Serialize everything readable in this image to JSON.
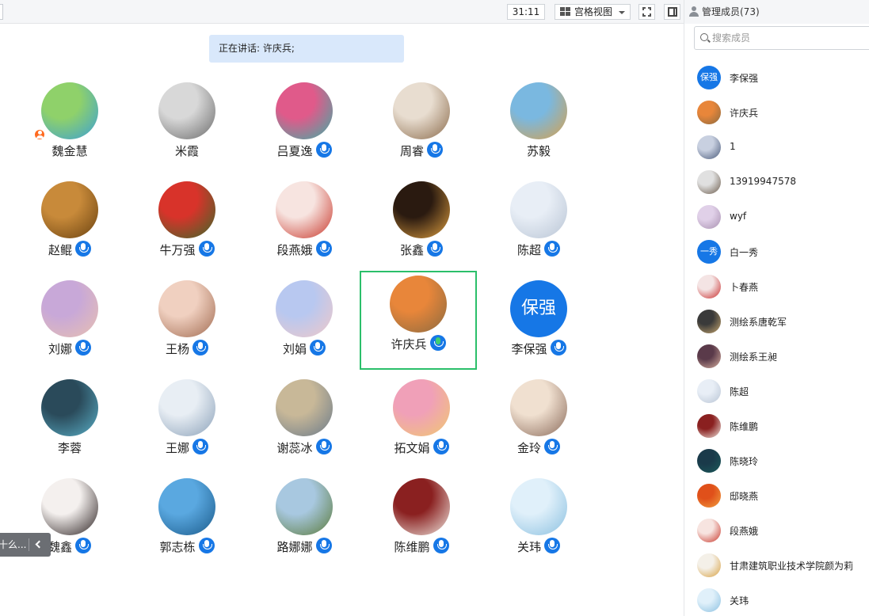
{
  "toolbar": {
    "timer": "31:11",
    "view_mode": "宫格视图"
  },
  "speaking": {
    "text": "正在讲话: 许庆兵;"
  },
  "participants": [
    {
      "name": "魏金慧",
      "mic": false,
      "host": true,
      "avatar_colors": [
        "#8fd16a",
        "#3a9fd8"
      ]
    },
    {
      "name": "米霞",
      "mic": false,
      "host": false,
      "avatar_colors": [
        "#d8d8d8",
        "#6a6a6a"
      ]
    },
    {
      "name": "吕夏逸",
      "mic": true,
      "host": false,
      "avatar_colors": [
        "#e05a8a",
        "#3ab0a6"
      ]
    },
    {
      "name": "周睿",
      "mic": true,
      "host": false,
      "avatar_colors": [
        "#e8ddd0",
        "#8a6a4a"
      ]
    },
    {
      "name": "苏毅",
      "mic": false,
      "host": false,
      "avatar_colors": [
        "#7ab8e0",
        "#d8a04a"
      ]
    },
    {
      "name": "赵鲲",
      "mic": true,
      "host": false,
      "avatar_colors": [
        "#c88a3a",
        "#6a4210"
      ]
    },
    {
      "name": "牛万强",
      "mic": true,
      "host": false,
      "avatar_colors": [
        "#d8332a",
        "#3a6a2a"
      ]
    },
    {
      "name": "段燕娥",
      "mic": true,
      "host": false,
      "avatar_colors": [
        "#f7e4e0",
        "#c8362a"
      ]
    },
    {
      "name": "张鑫",
      "mic": true,
      "host": false,
      "avatar_colors": [
        "#2a1a10",
        "#e0a040"
      ]
    },
    {
      "name": "陈超",
      "mic": true,
      "host": false,
      "avatar_colors": [
        "#e8eef6",
        "#b8c4d4"
      ]
    },
    {
      "name": "刘娜",
      "mic": true,
      "host": false,
      "avatar_colors": [
        "#c8a8d8",
        "#e8c0b0"
      ]
    },
    {
      "name": "王杨",
      "mic": true,
      "host": false,
      "avatar_colors": [
        "#f0d0c0",
        "#a06a50"
      ]
    },
    {
      "name": "刘娟",
      "mic": true,
      "host": false,
      "avatar_colors": [
        "#b8c8f0",
        "#f0c8c8"
      ]
    },
    {
      "name": "许庆兵",
      "mic": true,
      "host": false,
      "speaking": true,
      "avatar_colors": [
        "#e8863a",
        "#8a6a40"
      ]
    },
    {
      "name": "李保强",
      "mic": true,
      "host": false,
      "avatar_text": "保强",
      "avatar_colors": [
        "#1677e6",
        "#1677e6"
      ]
    },
    {
      "name": "李蓉",
      "mic": false,
      "host": false,
      "avatar_colors": [
        "#2a4a5a",
        "#5ab0c8"
      ]
    },
    {
      "name": "王娜",
      "mic": true,
      "host": false,
      "avatar_colors": [
        "#e8eef4",
        "#8aa0b8"
      ]
    },
    {
      "name": "谢蕊冰",
      "mic": true,
      "host": false,
      "avatar_colors": [
        "#c8b898",
        "#6a7a8a"
      ]
    },
    {
      "name": "拓文娟",
      "mic": true,
      "host": false,
      "avatar_colors": [
        "#f0a0b8",
        "#f0c870"
      ]
    },
    {
      "name": "金玲",
      "mic": true,
      "host": false,
      "avatar_colors": [
        "#f0e0d0",
        "#8a6a5a"
      ]
    },
    {
      "name": "魏鑫",
      "mic": true,
      "host": false,
      "avatar_colors": [
        "#f4f0ee",
        "#2a2020"
      ]
    },
    {
      "name": "郭志栋",
      "mic": true,
      "host": false,
      "avatar_colors": [
        "#5aa8e0",
        "#1a5a8a"
      ]
    },
    {
      "name": "路娜娜",
      "mic": true,
      "host": false,
      "avatar_colors": [
        "#a8c8e0",
        "#5a7a3a"
      ]
    },
    {
      "name": "陈维鹏",
      "mic": true,
      "host": false,
      "avatar_colors": [
        "#8a2020",
        "#f0e8e0"
      ]
    },
    {
      "name": "关玮",
      "mic": true,
      "host": false,
      "avatar_colors": [
        "#e0f0fa",
        "#8ac0e0"
      ]
    }
  ],
  "chat_tab": {
    "text": "十么..."
  },
  "members_panel": {
    "title": "管理成员(73)",
    "search_placeholder": "搜索成员",
    "members": [
      {
        "name": "李保强",
        "avatar_text": "保强",
        "avatar_colors": [
          "#1677e6",
          "#1677e6"
        ]
      },
      {
        "name": "许庆兵",
        "avatar_colors": [
          "#e8863a",
          "#8a6a40"
        ]
      },
      {
        "name": "1",
        "avatar_colors": [
          "#c8d0e0",
          "#4a5a7a"
        ]
      },
      {
        "name": "13919947578",
        "avatar_colors": [
          "#e0e0e0",
          "#6a5a4a"
        ]
      },
      {
        "name": "wyf",
        "avatar_colors": [
          "#e0d0e8",
          "#a890b0"
        ]
      },
      {
        "name": "白一秀",
        "avatar_text": "一秀",
        "avatar_colors": [
          "#1677e6",
          "#1677e6"
        ]
      },
      {
        "name": "卜春燕",
        "avatar_colors": [
          "#f4e4e4",
          "#c82a2a"
        ]
      },
      {
        "name": "测绘系唐乾军",
        "avatar_colors": [
          "#3a3a3a",
          "#c8a870"
        ]
      },
      {
        "name": "测绘系王昶",
        "avatar_colors": [
          "#5a3a4a",
          "#d8b0a0"
        ]
      },
      {
        "name": "陈超",
        "avatar_colors": [
          "#e8eef6",
          "#b8c4d4"
        ]
      },
      {
        "name": "陈维鹏",
        "avatar_colors": [
          "#8a2020",
          "#f0e8e0"
        ]
      },
      {
        "name": "陈晓玲",
        "avatar_colors": [
          "#1a3a4a",
          "#1a5a5a"
        ]
      },
      {
        "name": "邸晓燕",
        "avatar_colors": [
          "#e0501a",
          "#f0a040"
        ]
      },
      {
        "name": "段燕娥",
        "avatar_colors": [
          "#f7e4e0",
          "#c8362a"
        ]
      },
      {
        "name": "甘肃建筑职业技术学院颜为莉",
        "avatar_colors": [
          "#f4f0e8",
          "#d8a040"
        ]
      },
      {
        "name": "关玮",
        "avatar_colors": [
          "#e0f0fa",
          "#8ac0e0"
        ]
      }
    ]
  }
}
